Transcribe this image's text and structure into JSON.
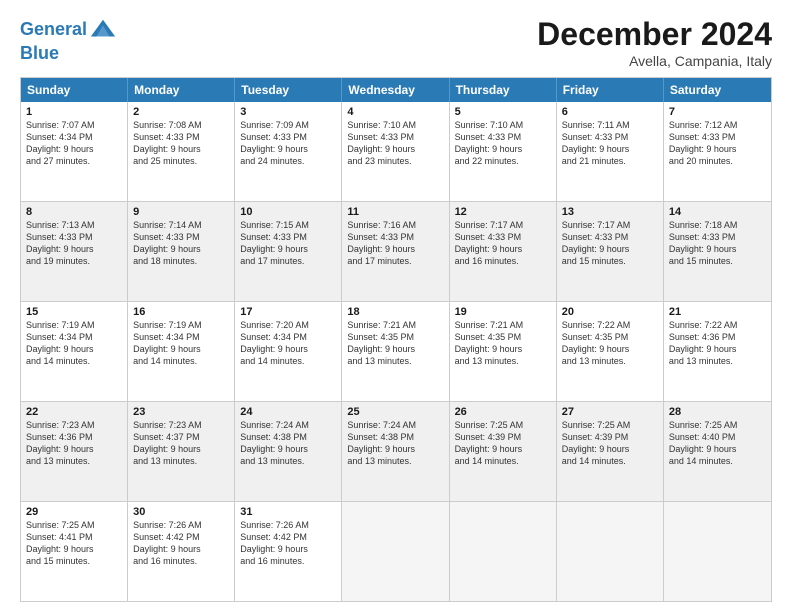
{
  "logo": {
    "line1": "General",
    "line2": "Blue"
  },
  "title": "December 2024",
  "subtitle": "Avella, Campania, Italy",
  "days": [
    "Sunday",
    "Monday",
    "Tuesday",
    "Wednesday",
    "Thursday",
    "Friday",
    "Saturday"
  ],
  "weeks": [
    [
      {
        "num": "1",
        "info": "Sunrise: 7:07 AM\nSunset: 4:34 PM\nDaylight: 9 hours\nand 27 minutes."
      },
      {
        "num": "2",
        "info": "Sunrise: 7:08 AM\nSunset: 4:33 PM\nDaylight: 9 hours\nand 25 minutes."
      },
      {
        "num": "3",
        "info": "Sunrise: 7:09 AM\nSunset: 4:33 PM\nDaylight: 9 hours\nand 24 minutes."
      },
      {
        "num": "4",
        "info": "Sunrise: 7:10 AM\nSunset: 4:33 PM\nDaylight: 9 hours\nand 23 minutes."
      },
      {
        "num": "5",
        "info": "Sunrise: 7:10 AM\nSunset: 4:33 PM\nDaylight: 9 hours\nand 22 minutes."
      },
      {
        "num": "6",
        "info": "Sunrise: 7:11 AM\nSunset: 4:33 PM\nDaylight: 9 hours\nand 21 minutes."
      },
      {
        "num": "7",
        "info": "Sunrise: 7:12 AM\nSunset: 4:33 PM\nDaylight: 9 hours\nand 20 minutes."
      }
    ],
    [
      {
        "num": "8",
        "info": "Sunrise: 7:13 AM\nSunset: 4:33 PM\nDaylight: 9 hours\nand 19 minutes."
      },
      {
        "num": "9",
        "info": "Sunrise: 7:14 AM\nSunset: 4:33 PM\nDaylight: 9 hours\nand 18 minutes."
      },
      {
        "num": "10",
        "info": "Sunrise: 7:15 AM\nSunset: 4:33 PM\nDaylight: 9 hours\nand 17 minutes."
      },
      {
        "num": "11",
        "info": "Sunrise: 7:16 AM\nSunset: 4:33 PM\nDaylight: 9 hours\nand 17 minutes."
      },
      {
        "num": "12",
        "info": "Sunrise: 7:17 AM\nSunset: 4:33 PM\nDaylight: 9 hours\nand 16 minutes."
      },
      {
        "num": "13",
        "info": "Sunrise: 7:17 AM\nSunset: 4:33 PM\nDaylight: 9 hours\nand 15 minutes."
      },
      {
        "num": "14",
        "info": "Sunrise: 7:18 AM\nSunset: 4:33 PM\nDaylight: 9 hours\nand 15 minutes."
      }
    ],
    [
      {
        "num": "15",
        "info": "Sunrise: 7:19 AM\nSunset: 4:34 PM\nDaylight: 9 hours\nand 14 minutes."
      },
      {
        "num": "16",
        "info": "Sunrise: 7:19 AM\nSunset: 4:34 PM\nDaylight: 9 hours\nand 14 minutes."
      },
      {
        "num": "17",
        "info": "Sunrise: 7:20 AM\nSunset: 4:34 PM\nDaylight: 9 hours\nand 14 minutes."
      },
      {
        "num": "18",
        "info": "Sunrise: 7:21 AM\nSunset: 4:35 PM\nDaylight: 9 hours\nand 13 minutes."
      },
      {
        "num": "19",
        "info": "Sunrise: 7:21 AM\nSunset: 4:35 PM\nDaylight: 9 hours\nand 13 minutes."
      },
      {
        "num": "20",
        "info": "Sunrise: 7:22 AM\nSunset: 4:35 PM\nDaylight: 9 hours\nand 13 minutes."
      },
      {
        "num": "21",
        "info": "Sunrise: 7:22 AM\nSunset: 4:36 PM\nDaylight: 9 hours\nand 13 minutes."
      }
    ],
    [
      {
        "num": "22",
        "info": "Sunrise: 7:23 AM\nSunset: 4:36 PM\nDaylight: 9 hours\nand 13 minutes."
      },
      {
        "num": "23",
        "info": "Sunrise: 7:23 AM\nSunset: 4:37 PM\nDaylight: 9 hours\nand 13 minutes."
      },
      {
        "num": "24",
        "info": "Sunrise: 7:24 AM\nSunset: 4:38 PM\nDaylight: 9 hours\nand 13 minutes."
      },
      {
        "num": "25",
        "info": "Sunrise: 7:24 AM\nSunset: 4:38 PM\nDaylight: 9 hours\nand 13 minutes."
      },
      {
        "num": "26",
        "info": "Sunrise: 7:25 AM\nSunset: 4:39 PM\nDaylight: 9 hours\nand 14 minutes."
      },
      {
        "num": "27",
        "info": "Sunrise: 7:25 AM\nSunset: 4:39 PM\nDaylight: 9 hours\nand 14 minutes."
      },
      {
        "num": "28",
        "info": "Sunrise: 7:25 AM\nSunset: 4:40 PM\nDaylight: 9 hours\nand 14 minutes."
      }
    ],
    [
      {
        "num": "29",
        "info": "Sunrise: 7:25 AM\nSunset: 4:41 PM\nDaylight: 9 hours\nand 15 minutes."
      },
      {
        "num": "30",
        "info": "Sunrise: 7:26 AM\nSunset: 4:42 PM\nDaylight: 9 hours\nand 16 minutes."
      },
      {
        "num": "31",
        "info": "Sunrise: 7:26 AM\nSunset: 4:42 PM\nDaylight: 9 hours\nand 16 minutes."
      },
      {
        "num": "",
        "info": ""
      },
      {
        "num": "",
        "info": ""
      },
      {
        "num": "",
        "info": ""
      },
      {
        "num": "",
        "info": ""
      }
    ]
  ]
}
